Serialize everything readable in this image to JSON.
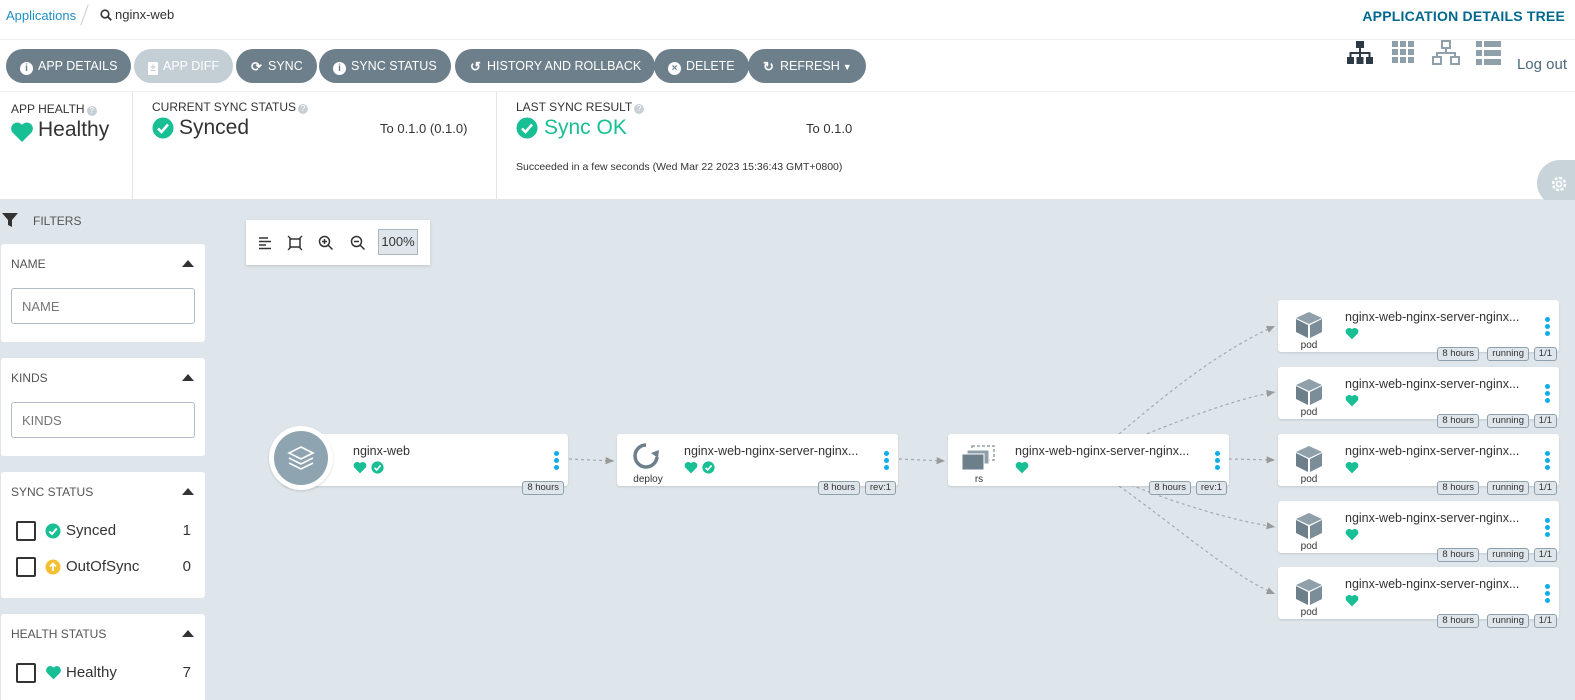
{
  "breadcrumb": {
    "applications": "Applications",
    "current": "nginx-web"
  },
  "page_title": "APPLICATION DETAILS TREE",
  "toolbar": {
    "buttons": [
      {
        "label": "APP DETAILS",
        "icon": "info-icon"
      },
      {
        "label": "APP DIFF",
        "icon": "file-diff-icon"
      },
      {
        "label": "SYNC",
        "icon": "sync-icon"
      },
      {
        "label": "SYNC STATUS",
        "icon": "info-icon"
      },
      {
        "label": "HISTORY AND ROLLBACK",
        "icon": "history-icon"
      },
      {
        "label": "DELETE",
        "icon": "delete-icon"
      },
      {
        "label": "REFRESH",
        "icon": "refresh-icon"
      }
    ],
    "logout": "Log out"
  },
  "status": {
    "app_health_label": "APP HEALTH",
    "app_health_value": "Healthy",
    "current_sync_label": "CURRENT SYNC STATUS",
    "current_sync_value": "Synced",
    "current_sync_to": "To 0.1.0 (0.1.0)",
    "last_sync_label": "LAST SYNC RESULT",
    "last_sync_value": "Sync OK",
    "last_sync_to": "To 0.1.0",
    "last_sync_detail": "Succeeded in a few seconds (Wed Mar 22 2023 15:36:43 GMT+0800)"
  },
  "filters": {
    "heading": "FILTERS",
    "name": {
      "title": "NAME",
      "placeholder": "NAME"
    },
    "kinds": {
      "title": "KINDS",
      "placeholder": "KINDS"
    },
    "sync_status": {
      "title": "SYNC STATUS",
      "items": [
        {
          "label": "Synced",
          "count": "1"
        },
        {
          "label": "OutOfSync",
          "count": "0"
        }
      ]
    },
    "health_status": {
      "title": "HEALTH STATUS",
      "items": [
        {
          "label": "Healthy",
          "count": "7"
        }
      ]
    }
  },
  "graph": {
    "zoom": "100%",
    "app_node": {
      "name": "nginx-web",
      "age": "8 hours"
    },
    "deploy_node": {
      "name": "nginx-web-nginx-server-nginx...",
      "kind": "deploy",
      "age": "8 hours",
      "rev": "rev:1"
    },
    "rs_node": {
      "name": "nginx-web-nginx-server-nginx...",
      "kind": "rs",
      "age": "8 hours",
      "rev": "rev:1"
    },
    "pods": [
      {
        "name": "nginx-web-nginx-server-nginx...",
        "kind": "pod",
        "age": "8 hours",
        "state": "running",
        "ready": "1/1"
      },
      {
        "name": "nginx-web-nginx-server-nginx...",
        "kind": "pod",
        "age": "8 hours",
        "state": "running",
        "ready": "1/1"
      },
      {
        "name": "nginx-web-nginx-server-nginx...",
        "kind": "pod",
        "age": "8 hours",
        "state": "running",
        "ready": "1/1"
      },
      {
        "name": "nginx-web-nginx-server-nginx...",
        "kind": "pod",
        "age": "8 hours",
        "state": "running",
        "ready": "1/1"
      },
      {
        "name": "nginx-web-nginx-server-nginx...",
        "kind": "pod",
        "age": "8 hours",
        "state": "running",
        "ready": "1/1"
      }
    ]
  },
  "colors": {
    "healthy": "#18be94",
    "out_of_sync": "#f4c030",
    "button": "#6d7f8b",
    "link": "#1f8fc5",
    "title": "#00688f",
    "menu_dots": "#0dadea"
  }
}
